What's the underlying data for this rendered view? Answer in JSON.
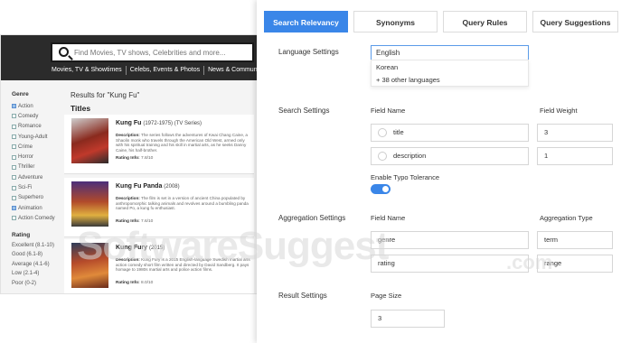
{
  "movie_app": {
    "search_placeholder": "Find Movies, TV shows, Celebrities and more...",
    "nav": [
      "Movies, TV & Showtimes",
      "Celebs, Events & Photos",
      "News & Community"
    ],
    "genre_heading": "Genre",
    "genres": [
      {
        "label": "Action",
        "checked": true
      },
      {
        "label": "Comedy",
        "checked": false
      },
      {
        "label": "Romance",
        "checked": false
      },
      {
        "label": "Young-Adult",
        "checked": false
      },
      {
        "label": "Crime",
        "checked": false
      },
      {
        "label": "Horror",
        "checked": false
      },
      {
        "label": "Thriller",
        "checked": false
      },
      {
        "label": "Adventure",
        "checked": false
      },
      {
        "label": "Sci-Fi",
        "checked": false
      },
      {
        "label": "Superhero",
        "checked": false
      },
      {
        "label": "Animation",
        "checked": true
      },
      {
        "label": "Action Comedy",
        "checked": false
      }
    ],
    "rating_heading": "Rating",
    "ratings": [
      "Excellent (8.1-10)",
      "Good (6.1-8)",
      "Average (4.1-6)",
      "Low (2.1-4)",
      "Poor (0-2)"
    ],
    "results_title": "Results for \"Kung Fu\"",
    "titles_heading": "Titles",
    "cards": [
      {
        "title": "Kung Fu",
        "year": "(1972-1975) (TV Series)",
        "description_label": "Description:",
        "description": "The series follows the adventures of Kwai Chang Caine, a Shaolin monk who travels through the American Old West, armed only with his spiritual training and his skill in martial arts, as he seeks Danny Caine, his half-brother.",
        "rating_label": "Rating Info:",
        "rating": "7.8/10"
      },
      {
        "title": "Kung Fu Panda",
        "year": "(2008)",
        "description_label": "Description:",
        "description": "The film is set in a version of ancient China populated by anthropomorphic talking animals and revolves around a bumbling panda named Po, a kung fu enthusiast.",
        "rating_label": "Rating Info:",
        "rating": "7.6/10"
      },
      {
        "title": "Kung Fury",
        "year": "(2015)",
        "description_label": "Description:",
        "description": "Kung Fury is a 2015 English-language Swedish martial arts action comedy short film written and directed by David Sandberg. It pays homage to 1980s martial arts and police action films.",
        "rating_label": "Rating Info:",
        "rating": "8.0/10"
      }
    ]
  },
  "settings": {
    "tabs": [
      "Search Relevancy",
      "Synonyms",
      "Query Rules",
      "Query Suggestions"
    ],
    "active_tab": "Search Relevancy",
    "language_label": "Language Settings",
    "language_value": "English",
    "language_options": [
      "Korean",
      "+ 38 other languages"
    ],
    "search_settings_label": "Search Settings",
    "field_name_label": "Field Name",
    "field_weight_label": "Field Weight",
    "search_fields": [
      {
        "name": "title",
        "weight": "3"
      },
      {
        "name": "description",
        "weight": "1"
      }
    ],
    "typo_label": "Enable Typo Tolerance",
    "typo_enabled": true,
    "aggregation_label": "Aggregation Settings",
    "aggregation_field_label": "Field Name",
    "aggregation_type_label": "Aggregation Type",
    "aggregations": [
      {
        "name": "genre",
        "type": "term"
      },
      {
        "name": "rating",
        "type": "range"
      }
    ],
    "result_label": "Result Settings",
    "page_size_label": "Page Size",
    "page_size": "3"
  },
  "watermark": {
    "main": "SoftwareSuggest",
    "suffix": ".com"
  },
  "colors": {
    "accent": "#3a86e8",
    "header_dark": "#2b2b2b"
  }
}
